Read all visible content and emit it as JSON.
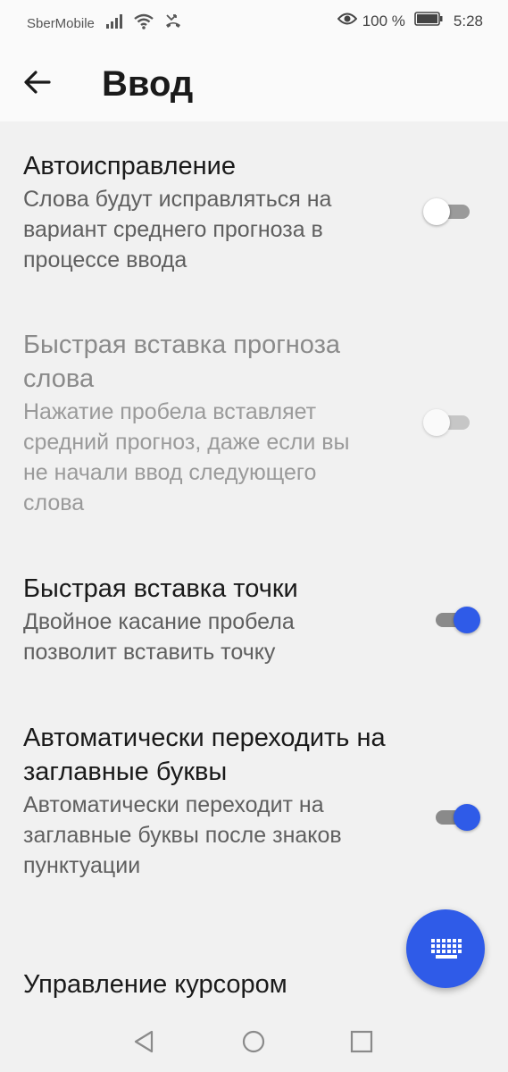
{
  "status_bar": {
    "carrier": "SberMobile",
    "battery_percent": "100 %",
    "time": "5:28",
    "icons": [
      "signal-icon",
      "wifi-icon",
      "missed-call-icon",
      "eye-icon",
      "battery-icon"
    ]
  },
  "app_bar": {
    "title": "Ввод",
    "back_icon": "arrow-back-icon"
  },
  "settings": [
    {
      "title": "Автоисправление",
      "subtitle": "Слова будут исправляться на вариант среднего прогноза в процессе ввода",
      "enabled": true,
      "checked": false
    },
    {
      "title": "Быстрая вставка прогноза слова",
      "subtitle": "Нажатие пробела вставляет средний прогноз, даже если вы не начали ввод следующего слова",
      "enabled": false,
      "checked": false
    },
    {
      "title": "Быстрая вставка точки",
      "subtitle": "Двойное касание пробела позволит вставить точку",
      "enabled": true,
      "checked": true
    },
    {
      "title": "Автоматически переходить на заглавные буквы",
      "subtitle": "Автоматически переходит на заглавные буквы после знаков пунктуации",
      "enabled": true,
      "checked": true
    },
    {
      "title": "Управление курсором",
      "subtitle": "",
      "enabled": true,
      "checked": null
    }
  ],
  "fab": {
    "icon": "keyboard-icon"
  },
  "nav_bar": {
    "icons": [
      "nav-back-icon",
      "nav-home-icon",
      "nav-recents-icon"
    ]
  },
  "colors": {
    "accent": "#2f5be8",
    "background": "#f1f1f1",
    "app_bar": "#fafafa"
  }
}
